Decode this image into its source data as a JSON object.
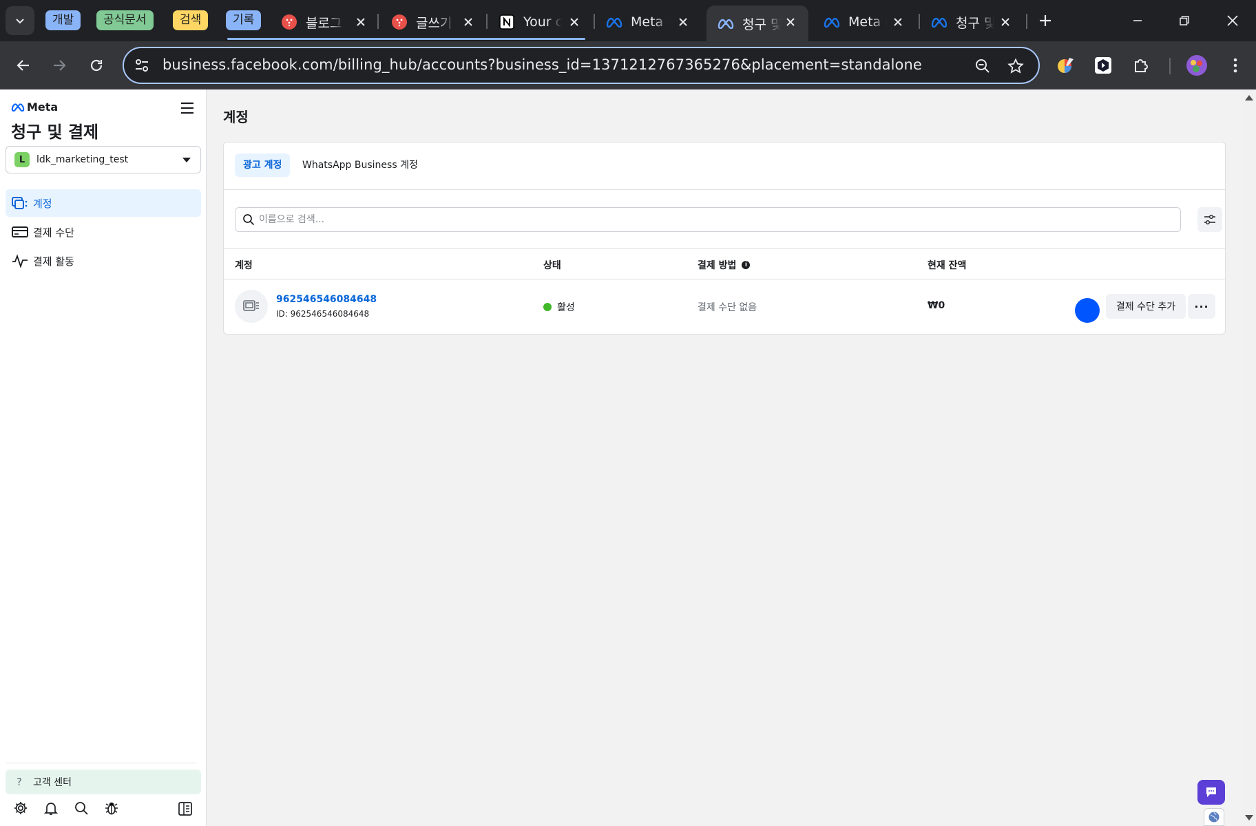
{
  "browser": {
    "tab_groups": [
      {
        "label": "개발",
        "color": "#8ab4f8"
      },
      {
        "label": "공식문서",
        "color": "#81c995"
      },
      {
        "label": "검색",
        "color": "#fdd663"
      },
      {
        "label": "기록",
        "color": "#8ab4f8"
      }
    ],
    "tabs": [
      {
        "title": "블로그",
        "icon": "red-dotted-favicon"
      },
      {
        "title": "글쓰기",
        "icon": "red-dotted-favicon"
      },
      {
        "title": "Your c",
        "icon": "notion-icon"
      },
      {
        "title": "Meta I",
        "icon": "meta-icon"
      },
      {
        "title": "청구 및",
        "icon": "meta-icon",
        "active": true
      },
      {
        "title": "Meta I",
        "icon": "meta-icon"
      },
      {
        "title": "청구 및",
        "icon": "meta-icon"
      }
    ],
    "url": "business.facebook.com/billing_hub/accounts?business_id=1371212767365276&placement=standalone"
  },
  "sidebar": {
    "brand": "Meta",
    "title": "청구 및 결제",
    "business": {
      "initial": "L",
      "name": "ldk_marketing_test"
    },
    "nav": [
      {
        "label": "계정",
        "icon": "accounts-icon",
        "active": true
      },
      {
        "label": "결제 수단",
        "icon": "credit-card-icon"
      },
      {
        "label": "결제 활동",
        "icon": "activity-icon"
      }
    ],
    "help": "고객 센터"
  },
  "main": {
    "title": "계정",
    "tabs": [
      "광고 계정",
      "WhatsApp Business 계정"
    ],
    "search_placeholder": "이름으로 검색...",
    "columns": [
      "계정",
      "상태",
      "결제 방법",
      "현재 잔액"
    ],
    "rows": [
      {
        "name": "962546546084648",
        "id": "ID: 962546546084648",
        "status": "활성",
        "payment_method": "결제 수단 없음",
        "balance": "₩0",
        "action": "결제 수단 추가",
        "more": "···"
      }
    ]
  },
  "colors": {
    "accent": "#0a66d8",
    "active_status": "#42b72a",
    "chat": "#5b3fd6"
  }
}
